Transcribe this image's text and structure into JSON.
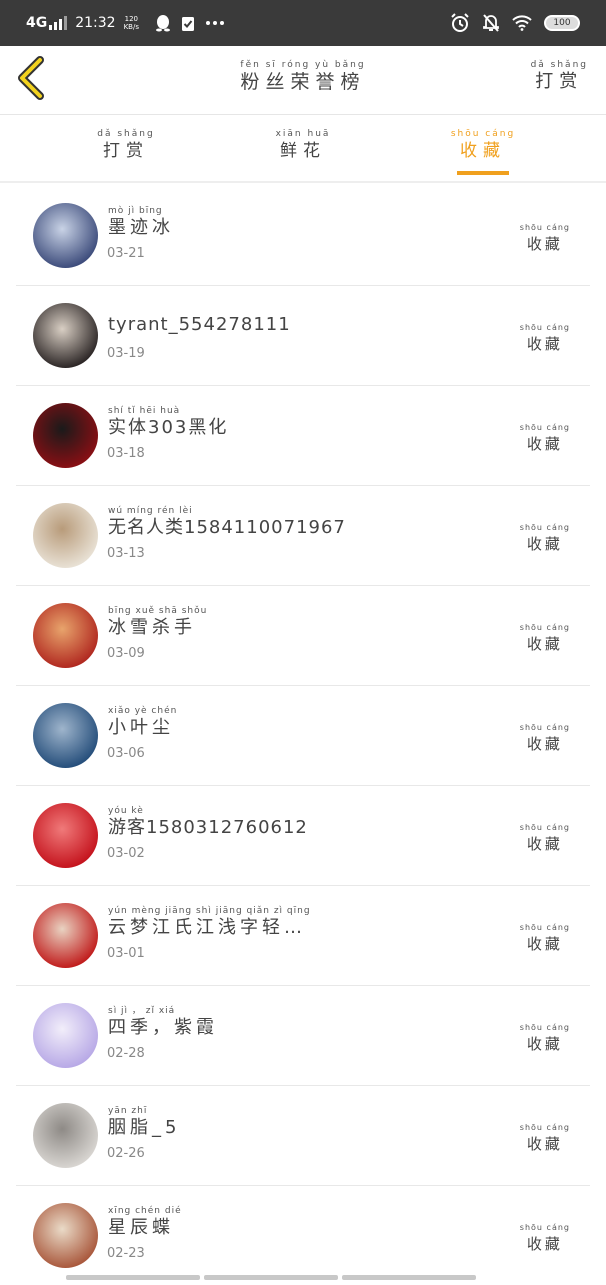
{
  "status_bar": {
    "network": "4G",
    "time": "21:32",
    "speed_value": "120",
    "speed_unit": "KB/s",
    "battery": "100",
    "icons": [
      "qq-icon",
      "check-clipboard-icon",
      "more-dots-icon",
      "alarm-icon",
      "bell-off-icon",
      "wifi-icon"
    ]
  },
  "header": {
    "title_pinyin": "fěn sī róng yù bǎng",
    "title": "粉丝荣誉榜",
    "right_pinyin": "dǎ shǎng",
    "right_label": "打赏"
  },
  "tabs": [
    {
      "pinyin": "dǎ shǎng",
      "label": "打赏",
      "active": false
    },
    {
      "pinyin": "xiān huā",
      "label": "鲜花",
      "active": false
    },
    {
      "pinyin": "shōu cáng",
      "label": "收藏",
      "active": true
    }
  ],
  "rows": [
    {
      "name_pinyin": "mò jì bīng",
      "name": "墨迹冰",
      "date": "03-21",
      "action_pinyin": "shōu cáng",
      "action": "收藏",
      "avatar_colors": [
        "#3b4a7a",
        "#c9d3e6"
      ]
    },
    {
      "name_pinyin": "",
      "name": "tyrant_554278111",
      "date": "03-19",
      "action_pinyin": "shōu cáng",
      "action": "收藏",
      "avatar_colors": [
        "#2a2424",
        "#d9cfc4"
      ]
    },
    {
      "name_pinyin": "shí tǐ  hēi huà",
      "name": "实体303黑化",
      "date": "03-18",
      "action_pinyin": "shōu cáng",
      "action": "收藏",
      "avatar_colors": [
        "#8a0f14",
        "#1a1a1a"
      ]
    },
    {
      "name_pinyin": "wú míng rén lèi",
      "name": "无名人类1584110071967",
      "date": "03-13",
      "action_pinyin": "shōu cáng",
      "action": "收藏",
      "avatar_colors": [
        "#e9e2d6",
        "#b89b7a"
      ]
    },
    {
      "name_pinyin": "bīng xuě shā shǒu",
      "name": "冰雪杀手",
      "date": "03-09",
      "action_pinyin": "shōu cáng",
      "action": "收藏",
      "avatar_colors": [
        "#b0271f",
        "#e8a46c"
      ]
    },
    {
      "name_pinyin": "xiǎo yè chén",
      "name": "小叶尘",
      "date": "03-06",
      "action_pinyin": "shōu cáng",
      "action": "收藏",
      "avatar_colors": [
        "#244d7a",
        "#9fb5cc"
      ]
    },
    {
      "name_pinyin": "yóu kè",
      "name": "游客1580312760612",
      "date": "03-02",
      "action_pinyin": "shōu cáng",
      "action": "收藏",
      "avatar_colors": [
        "#c4121c",
        "#f07a7a"
      ]
    },
    {
      "name_pinyin": "yún mèng jiāng shì jiāng qiǎn zì qīng",
      "name": "云梦江氏江浅字轻…",
      "date": "03-01",
      "action_pinyin": "shōu cáng",
      "action": "收藏",
      "avatar_colors": [
        "#c01a1a",
        "#e9d3c2"
      ]
    },
    {
      "name_pinyin": "sì jì ， zǐ xiá",
      "name": "四季，紫霞",
      "date": "02-28",
      "action_pinyin": "shōu cáng",
      "action": "收藏",
      "avatar_colors": [
        "#b7a8e6",
        "#f2eefa"
      ]
    },
    {
      "name_pinyin": "yān zhī",
      "name": "胭脂_5",
      "date": "02-26",
      "action_pinyin": "shōu cáng",
      "action": "收藏",
      "avatar_colors": [
        "#d9d6d2",
        "#8e8a86"
      ]
    },
    {
      "name_pinyin": "xīng chén dié",
      "name": "星辰蝶",
      "date": "02-23",
      "action_pinyin": "shōu cáng",
      "action": "收藏",
      "avatar_colors": [
        "#a8563a",
        "#eadbc8"
      ]
    }
  ],
  "colors": {
    "accent": "#f0a01e",
    "status_bar": "#3a3a3a",
    "divider": "#e8e8e8"
  }
}
